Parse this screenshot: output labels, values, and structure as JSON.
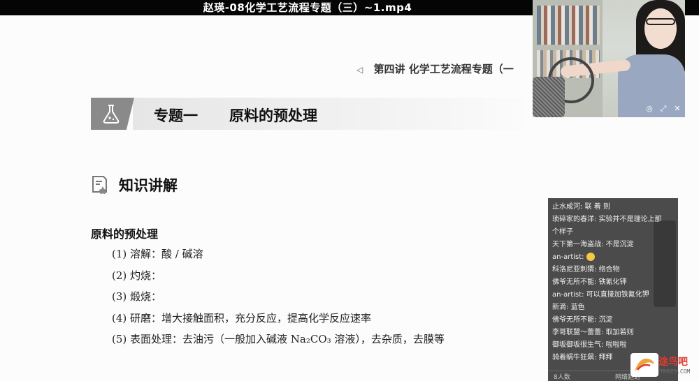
{
  "window": {
    "title": "赵瑛-08化学工艺流程专题（三）~1.mp4"
  },
  "slide": {
    "header": "第四讲  化学工艺流程专题（一",
    "banner": {
      "label": "专题一",
      "name": "原料的预处理"
    },
    "section_heading": "知识讲解",
    "list_title": "原料的预处理",
    "items": [
      "(1) 溶解：酸 / 碱溶",
      "(2) 灼烧：",
      "(3) 煅烧：",
      "(4) 研磨：增大接触面积，充分反应，提高化学反应速率",
      "(5) 表面处理：去油污（一般加入碱液 Na₂CO₃ 溶液），去杂质，去膜等"
    ]
  },
  "video": {
    "controls": [
      "◎",
      "⤢",
      "✕"
    ]
  },
  "chat": {
    "messages": [
      {
        "user": "止水成河:",
        "text": "联  着  则"
      },
      {
        "user": "琐碎家的春洋:",
        "text": "实验并不是理论上那"
      },
      {
        "user": "",
        "text": "个样子"
      },
      {
        "user": "天下第一海盗战:",
        "text": "不是沉淀"
      },
      {
        "user": "an-artist:",
        "text": "",
        "emoji": true
      },
      {
        "user": "科洛尼亚刺猬:",
        "text": "络合物"
      },
      {
        "user": "佛爷无所不能:",
        "text": "铁氰化钾"
      },
      {
        "user": "an-artist:",
        "text": "可以直接加铁氰化钾"
      },
      {
        "user": "新滴:",
        "text": "蓝色"
      },
      {
        "user": "佛爷无所不能:",
        "text": "沉淀"
      },
      {
        "user": "李哥联盟～蕾蕾:",
        "text": "取加若则"
      },
      {
        "user": "御坂御坂很生气:",
        "text": "啦啦啦"
      },
      {
        "user": "骑着蜗牛狂飙:",
        "text": "拜拜"
      }
    ],
    "footer": {
      "left": "8人数",
      "right": "网络延迟"
    }
  },
  "watermark": {
    "brand": "途鸟吧",
    "url": "TNBZS.COM"
  }
}
